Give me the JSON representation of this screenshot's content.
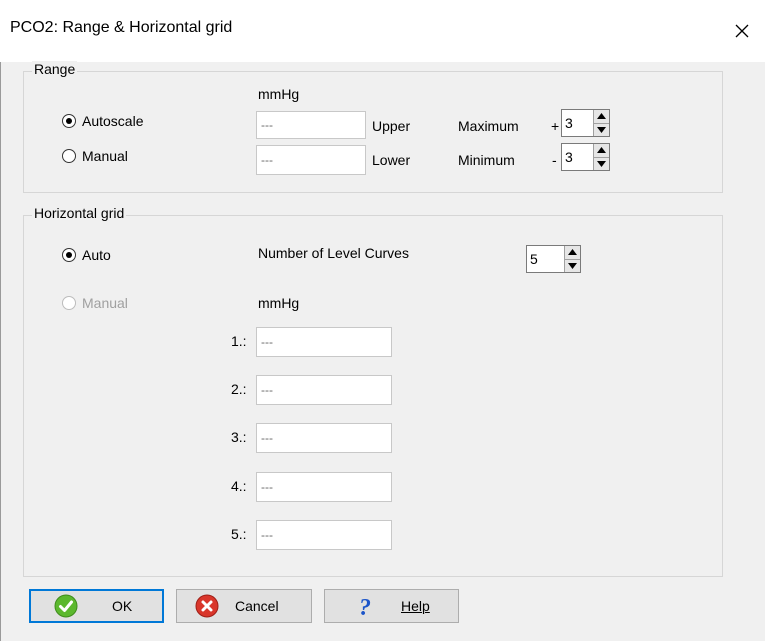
{
  "window": {
    "title": "PCO2: Range & Horizontal grid"
  },
  "range": {
    "legend": "Range",
    "unit": "mmHg",
    "autoscale_label": "Autoscale",
    "manual_label": "Manual",
    "upper_value": "---",
    "lower_value": "---",
    "upper_label": "Upper",
    "lower_label": "Lower",
    "maximum_label": "Maximum",
    "minimum_label": "Minimum",
    "max_sign": "+",
    "min_sign": "-",
    "max_value": "3",
    "min_value": "3",
    "selected": "Autoscale"
  },
  "grid": {
    "legend": "Horizontal grid",
    "auto_label": "Auto",
    "manual_label": "Manual",
    "curves_label": "Number of Level Curves",
    "curves_value": "5",
    "unit": "mmHg",
    "selected": "Auto",
    "levels": [
      {
        "label": "1.:",
        "value": "---"
      },
      {
        "label": "2.:",
        "value": "---"
      },
      {
        "label": "3.:",
        "value": "---"
      },
      {
        "label": "4.:",
        "value": "---"
      },
      {
        "label": "5.:",
        "value": "---"
      }
    ]
  },
  "buttons": {
    "ok": {
      "label": "OK",
      "icon": "check-circle-icon"
    },
    "cancel": {
      "label": "Cancel",
      "icon": "x-circle-icon"
    },
    "help": {
      "label": "Help",
      "icon": "question-mark-icon"
    }
  },
  "colors": {
    "focus_border": "#0078d7",
    "ok_icon": "#5cb82e",
    "cancel_icon": "#d9362b",
    "help_icon": "#1c55c9"
  }
}
